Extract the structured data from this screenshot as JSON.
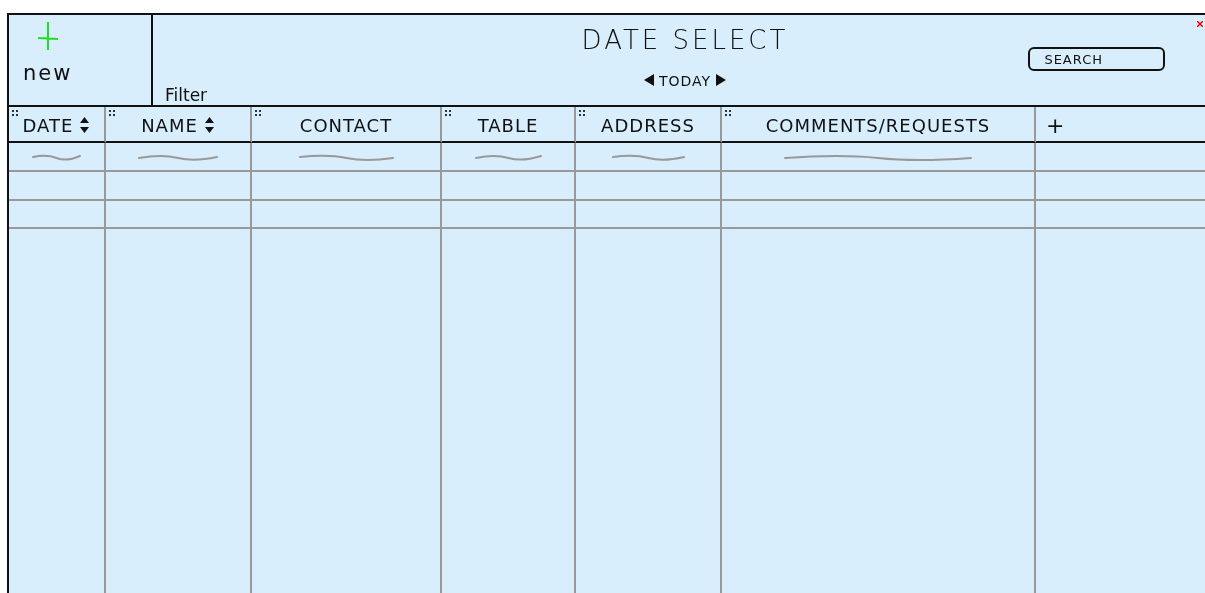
{
  "toolbar": {
    "new_label": "new",
    "filter_label": "Filter"
  },
  "title": "DATE SELECT",
  "date_nav": {
    "label": "TODAY"
  },
  "search": {
    "label": "SEARCH"
  },
  "table": {
    "columns": [
      {
        "label": "DATE",
        "sortable": true
      },
      {
        "label": "NAME",
        "sortable": true
      },
      {
        "label": "CONTACT",
        "sortable": false
      },
      {
        "label": "TABLE",
        "sortable": false
      },
      {
        "label": "ADDRESS",
        "sortable": false
      },
      {
        "label": "COMMENTS/REQUESTS",
        "sortable": false
      }
    ],
    "add_column": "+",
    "rows": [
      {
        "kind": "scribble"
      },
      {
        "kind": "empty"
      },
      {
        "kind": "empty"
      }
    ]
  }
}
